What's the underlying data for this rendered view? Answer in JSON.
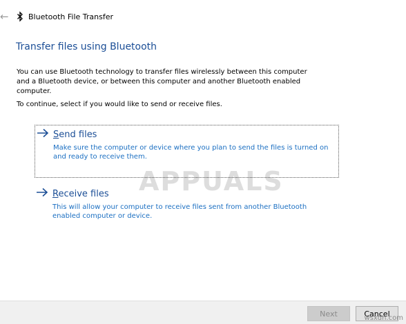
{
  "window": {
    "title": "Bluetooth File Transfer",
    "back_icon": "back-arrow-icon"
  },
  "main": {
    "heading": "Transfer files using Bluetooth",
    "intro": "You can use Bluetooth technology to transfer files wirelessly between this computer and a Bluetooth device, or between this computer and another Bluetooth enabled computer.",
    "instruction": "To continue, select if you would like to send or receive files.",
    "options": [
      {
        "first_letter": "S",
        "rest": "end files",
        "description": "Make sure the computer or device where you plan to send the files is turned on and ready to receive them."
      },
      {
        "first_letter": "R",
        "rest": "eceive files",
        "description": "This will allow your computer to receive files sent from another Bluetooth enabled computer or device."
      }
    ]
  },
  "footer": {
    "next_label": "Next",
    "cancel_label": "Cancel"
  },
  "watermark": {
    "text": "APPUALS"
  },
  "site_label": "wsxdn.com",
  "colors": {
    "accent": "#1b4e96",
    "link_desc": "#1b6fc2",
    "footer_bg": "#f0f0f0"
  }
}
